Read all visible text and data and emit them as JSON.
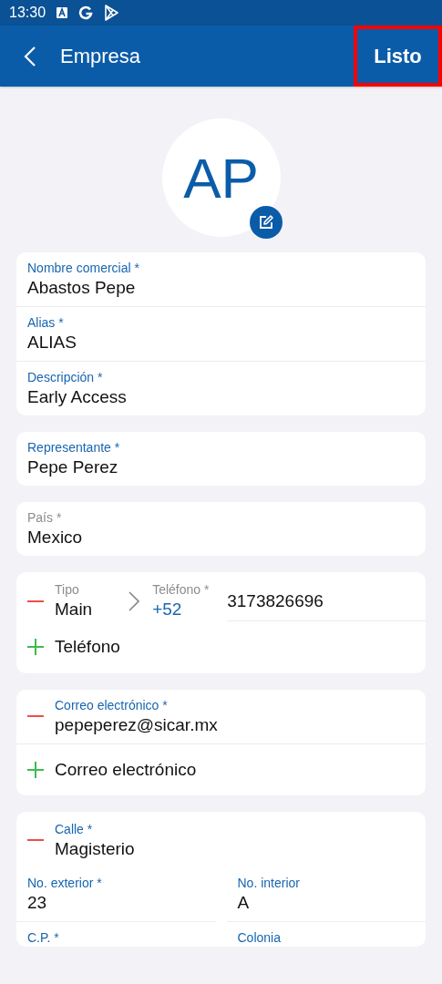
{
  "status_bar": {
    "time": "13:30"
  },
  "app_bar": {
    "title": "Empresa",
    "done_button": {
      "label": "Listo",
      "highlighted": true
    }
  },
  "avatar": {
    "initials": "AP"
  },
  "cards": [
    {
      "kind": "fields",
      "fields": [
        {
          "label": "Nombre comercial *",
          "value": "Abastos Pepe",
          "kind": "text"
        },
        {
          "label": "Alias *",
          "value": "ALIAS",
          "kind": "text"
        },
        {
          "label": "Descripción *",
          "value": "Early Access",
          "kind": "text"
        }
      ]
    },
    {
      "kind": "fields",
      "fields": [
        {
          "label": "Representante *",
          "value": "Pepe Perez",
          "kind": "text"
        }
      ]
    },
    {
      "kind": "fields",
      "fields": [
        {
          "label": "País *",
          "value": "Mexico",
          "kind": "picker"
        }
      ]
    },
    {
      "kind": "phones",
      "items": [
        {
          "type_label": "Tipo",
          "type": "Main",
          "phone_label": "Teléfono *",
          "code": "+52",
          "number": "3173826696"
        }
      ],
      "add_label": "Teléfono"
    },
    {
      "kind": "emails",
      "items": [
        {
          "label": "Correo electrónico *",
          "value": "pepeperez@sicar.mx"
        }
      ],
      "add_label": "Correo electrónico"
    },
    {
      "kind": "address",
      "street": {
        "label": "Calle *",
        "value": "Magisterio"
      },
      "pairs": [
        [
          {
            "label": "No. exterior *",
            "value": "23"
          },
          {
            "label": "No. interior",
            "value": "A"
          }
        ],
        [
          {
            "label": "C.P. *"
          },
          {
            "label": "Colonia"
          }
        ]
      ]
    }
  ]
}
